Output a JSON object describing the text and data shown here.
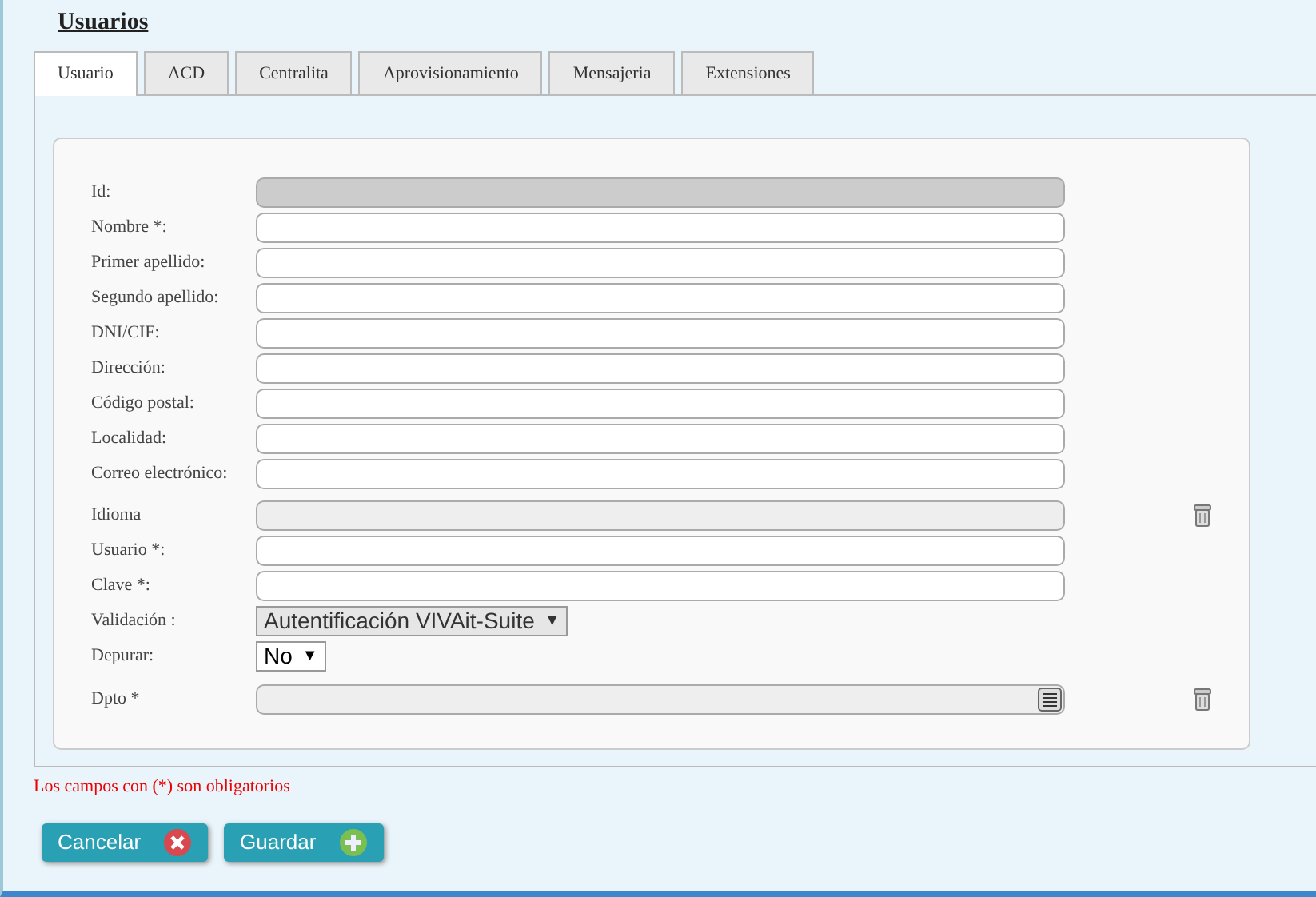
{
  "title": "Usuarios",
  "tabs": [
    {
      "label": "Usuario",
      "selected": true
    },
    {
      "label": "ACD",
      "selected": false
    },
    {
      "label": "Centralita",
      "selected": false
    },
    {
      "label": "Aprovisionamiento",
      "selected": false
    },
    {
      "label": "Mensajeria",
      "selected": false
    },
    {
      "label": "Extensiones",
      "selected": false
    }
  ],
  "fields": [
    {
      "label": "Id:",
      "kind": "locked"
    },
    {
      "label": "Nombre *:",
      "kind": "text"
    },
    {
      "label": "Primer apellido:",
      "kind": "text"
    },
    {
      "label": "Segundo apellido:",
      "kind": "text"
    },
    {
      "label": "DNI/CIF:",
      "kind": "text"
    },
    {
      "label": "Dirección:",
      "kind": "text"
    },
    {
      "label": "Código postal:",
      "kind": "text"
    },
    {
      "label": "Localidad:",
      "kind": "text"
    },
    {
      "label": "Correo electrónico:",
      "kind": "text"
    },
    {
      "label": "Idioma",
      "kind": "lookup"
    },
    {
      "label": "Usuario *:",
      "kind": "text"
    },
    {
      "label": "Clave *:",
      "kind": "text"
    },
    {
      "label": "Validación :",
      "kind": "select",
      "value": "Autentificación VIVAit-Suite",
      "caret": "▼"
    },
    {
      "label": "Depurar:",
      "kind": "select",
      "value": "No",
      "caret": "▼"
    },
    {
      "label": "Dpto *",
      "kind": "picker"
    }
  ],
  "note": "Los campos con (*) son obligatorios",
  "buttons": [
    {
      "label": "Cancelar",
      "kind": "cancel"
    },
    {
      "label": "Guardar",
      "kind": "save"
    }
  ]
}
